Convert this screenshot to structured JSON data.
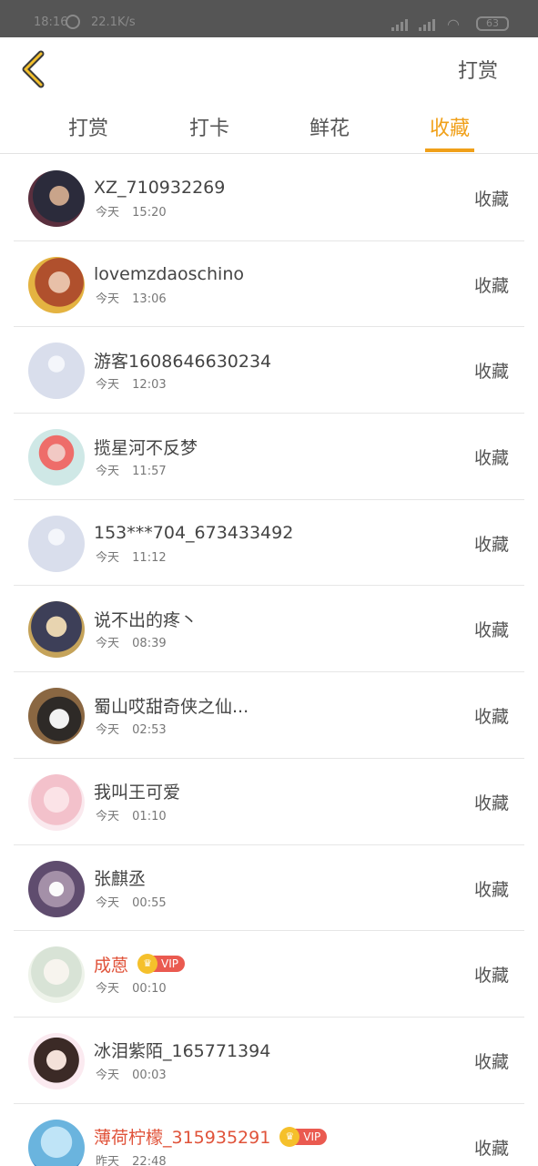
{
  "status_bar": {
    "time": "18:16",
    "speed": "22.1K/s",
    "battery": "63",
    "icons": [
      "alarm-icon",
      "signal-icon",
      "signal-hd-icon",
      "wifi-icon",
      "battery-icon"
    ]
  },
  "header": {
    "back_icon": "chevron-left-icon",
    "action": "打赏"
  },
  "tabs": [
    {
      "label": "打赏",
      "active": false
    },
    {
      "label": "打卡",
      "active": false
    },
    {
      "label": "鲜花",
      "active": false
    },
    {
      "label": "收藏",
      "active": true
    }
  ],
  "colors": {
    "accent": "#f0a019",
    "vip_name": "#e0533a",
    "vip_tag": "#ea5a50",
    "crown": "#f5c02b"
  },
  "items": [
    {
      "name": "XZ_710932269",
      "day": "今天",
      "time": "15:20",
      "action": "收藏",
      "vip": false
    },
    {
      "name": "lovemzdaoschino",
      "day": "今天",
      "time": "13:06",
      "action": "收藏",
      "vip": false
    },
    {
      "name": "游客1608646630234",
      "day": "今天",
      "time": "12:03",
      "action": "收藏",
      "vip": false
    },
    {
      "name": "揽星河不反梦",
      "day": "今天",
      "time": "11:57",
      "action": "收藏",
      "vip": false
    },
    {
      "name": "153***704_673433492",
      "day": "今天",
      "time": "11:12",
      "action": "收藏",
      "vip": false
    },
    {
      "name": "说不出的疼丶",
      "day": "今天",
      "time": "08:39",
      "action": "收藏",
      "vip": false
    },
    {
      "name": "蜀山哎甜奇侠之仙...",
      "day": "今天",
      "time": "02:53",
      "action": "收藏",
      "vip": false
    },
    {
      "name": "我叫王可爱",
      "day": "今天",
      "time": "01:10",
      "action": "收藏",
      "vip": false
    },
    {
      "name": "张麒丞",
      "day": "今天",
      "time": "00:55",
      "action": "收藏",
      "vip": false
    },
    {
      "name": "成蒽",
      "day": "今天",
      "time": "00:10",
      "action": "收藏",
      "vip": true,
      "badge": "VIP"
    },
    {
      "name": "冰泪紫陌_165771394",
      "day": "今天",
      "time": "00:03",
      "action": "收藏",
      "vip": false
    },
    {
      "name": "薄荷柠檬_315935291",
      "day": "昨天",
      "time": "22:48",
      "action": "收藏",
      "vip": true,
      "badge": "VIP"
    }
  ]
}
